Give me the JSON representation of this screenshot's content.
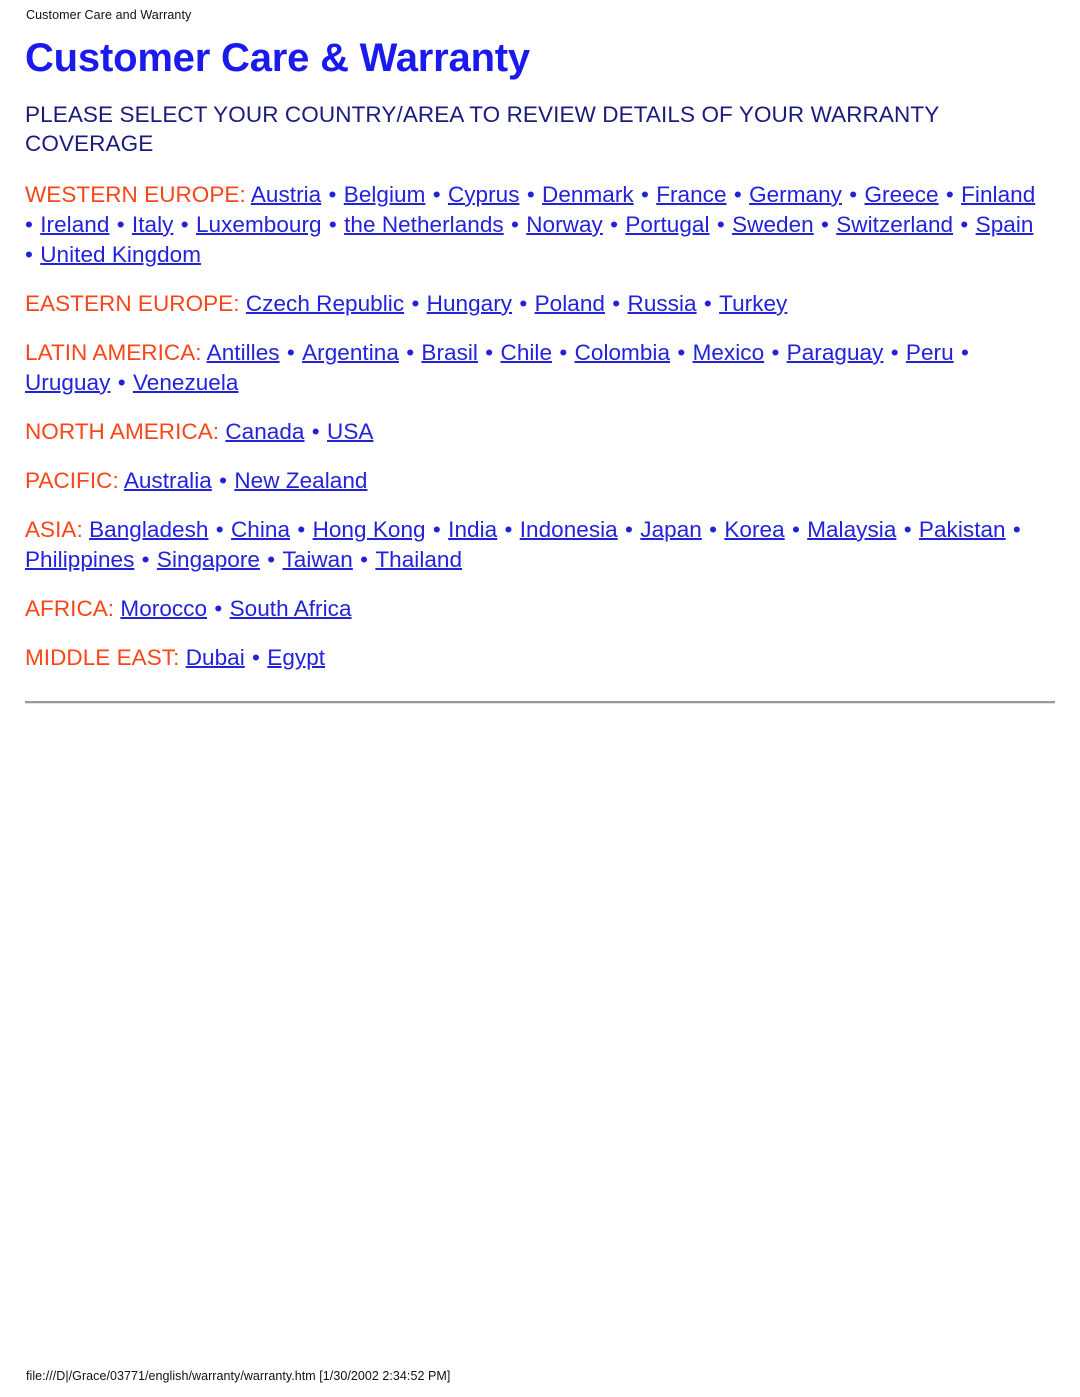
{
  "print_header": "Customer Care and Warranty",
  "print_footer": "file:///D|/Grace/03771/english/warranty/warranty.htm [1/30/2002 2:34:52 PM]",
  "document": {
    "title": "Customer Care & Warranty",
    "lead": "PLEASE SELECT YOUR COUNTRY/AREA TO REVIEW DETAILS OF YOUR WARRANTY COVERAGE"
  },
  "colors": {
    "title_blue": "#1a1aee",
    "lead_navy": "#1b1b7e",
    "region_label_orange": "#fa4616",
    "link_blue": "#2222dd",
    "rule_gray": "#9a9a9a"
  },
  "separator": "•",
  "regions": [
    {
      "label": "WESTERN EUROPE:",
      "countries": [
        "Austria",
        "Belgium",
        "Cyprus",
        "Denmark",
        "France",
        "Germany",
        "Greece",
        "Finland",
        "Ireland",
        "Italy",
        "Luxembourg",
        "the Netherlands",
        "Norway",
        "Portugal",
        "Sweden",
        "Switzerland",
        "Spain",
        "United Kingdom"
      ]
    },
    {
      "label": "EASTERN EUROPE:",
      "countries": [
        "Czech Republic",
        "Hungary",
        "Poland",
        "Russia",
        "Turkey"
      ]
    },
    {
      "label": "LATIN AMERICA:",
      "countries": [
        "Antilles",
        "Argentina",
        "Brasil",
        "Chile",
        "Colombia",
        "Mexico",
        "Paraguay",
        "Peru",
        "Uruguay",
        "Venezuela"
      ]
    },
    {
      "label": "NORTH AMERICA:",
      "countries": [
        "Canada",
        "USA"
      ]
    },
    {
      "label": "PACIFIC:",
      "countries": [
        "Australia",
        "New Zealand"
      ]
    },
    {
      "label": "ASIA:",
      "countries": [
        "Bangladesh",
        "China",
        "Hong Kong",
        "India",
        "Indonesia",
        "Japan",
        "Korea",
        "Malaysia",
        "Pakistan",
        "Philippines",
        "Singapore",
        "Taiwan",
        "Thailand"
      ]
    },
    {
      "label": "AFRICA:",
      "countries": [
        "Morocco",
        "South Africa"
      ]
    },
    {
      "label": "MIDDLE EAST:",
      "countries": [
        "Dubai",
        "Egypt"
      ]
    }
  ]
}
